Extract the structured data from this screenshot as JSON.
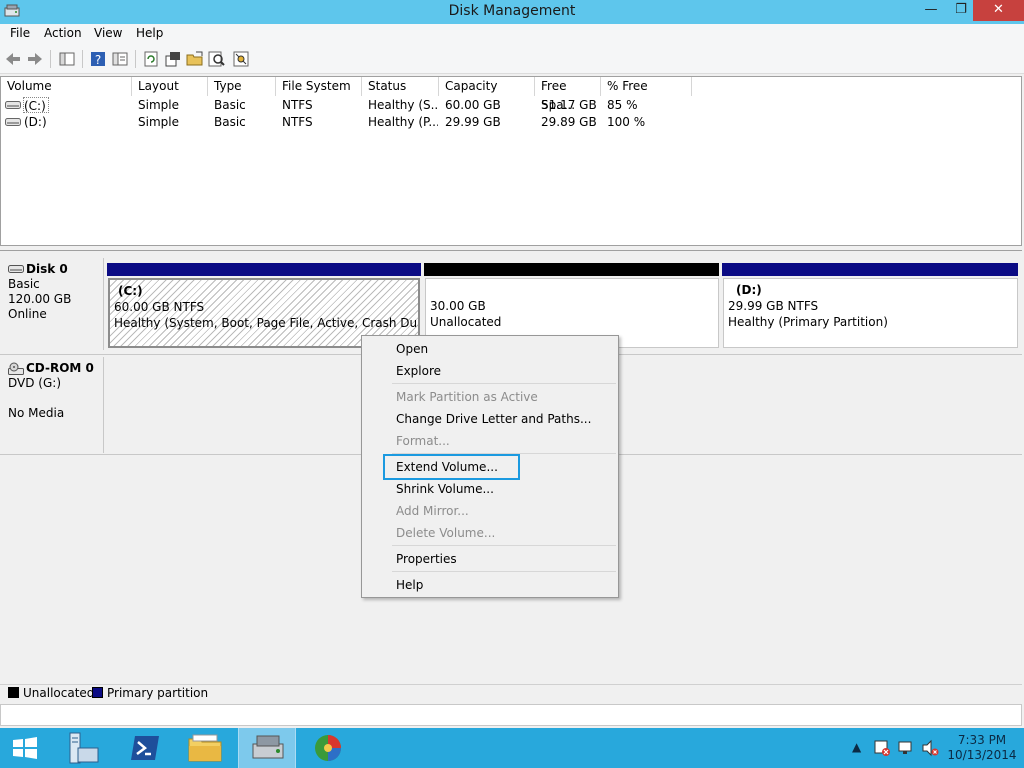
{
  "window": {
    "title": "Disk Management",
    "controls": {
      "minimize": "—",
      "restore": "❐",
      "close": "✕"
    }
  },
  "menubar": [
    "File",
    "Action",
    "View",
    "Help"
  ],
  "toolbar": {
    "icons": [
      "back-icon",
      "forward-icon",
      "console-tree-icon",
      "help-icon",
      "properties-icon",
      "refresh-icon",
      "rescan-icon",
      "open-icon",
      "search-icon",
      "settings-icon"
    ]
  },
  "volume_list": {
    "columns": [
      "Volume",
      "Layout",
      "Type",
      "File System",
      "Status",
      "Capacity",
      "Free Spa...",
      "% Free"
    ],
    "rows": [
      {
        "volume": "(C:)",
        "layout": "Simple",
        "type": "Basic",
        "fs": "NTFS",
        "status": "Healthy (S...",
        "capacity": "60.00 GB",
        "free": "51.17 GB",
        "pct": "85 %"
      },
      {
        "volume": "(D:)",
        "layout": "Simple",
        "type": "Basic",
        "fs": "NTFS",
        "status": "Healthy (P...",
        "capacity": "29.99 GB",
        "free": "29.89 GB",
        "pct": "100 %"
      }
    ]
  },
  "disks": [
    {
      "name": "Disk 0",
      "type": "Basic",
      "size": "120.00 GB",
      "state": "Online",
      "partitions": [
        {
          "label": "(C:)",
          "size": "60.00 GB NTFS",
          "status": "Healthy (System, Boot, Page File, Active, Crash Dump, Pri"
        },
        {
          "label": "",
          "size": "30.00 GB",
          "status": "Unallocated"
        },
        {
          "label": "(D:)",
          "size": "29.99 GB NTFS",
          "status": "Healthy (Primary Partition)"
        }
      ]
    },
    {
      "name": "CD-ROM 0",
      "type": "DVD (G:)",
      "size": "",
      "state": "No Media"
    }
  ],
  "context_menu": {
    "open": "Open",
    "explore": "Explore",
    "mark_active": "Mark Partition as Active",
    "change_letter": "Change Drive Letter and Paths...",
    "format": "Format...",
    "extend": "Extend Volume...",
    "shrink": "Shrink Volume...",
    "add_mirror": "Add Mirror...",
    "delete": "Delete Volume...",
    "properties": "Properties",
    "help": "Help"
  },
  "legend": {
    "unallocated": "Unallocated",
    "primary": "Primary partition"
  },
  "colors": {
    "titlebar": "#5ec6ec",
    "primary": "#0b0b84",
    "unallocated": "#000000",
    "taskbar": "#28a8dc",
    "highlight": "#1b9ae0"
  },
  "taskbar": {
    "apps": [
      "start-icon",
      "server-manager-icon",
      "powershell-icon",
      "file-explorer-icon",
      "disk-management-icon",
      "partition-tool-icon"
    ],
    "clock": {
      "time": "7:33 PM",
      "date": "10/13/2014"
    }
  }
}
